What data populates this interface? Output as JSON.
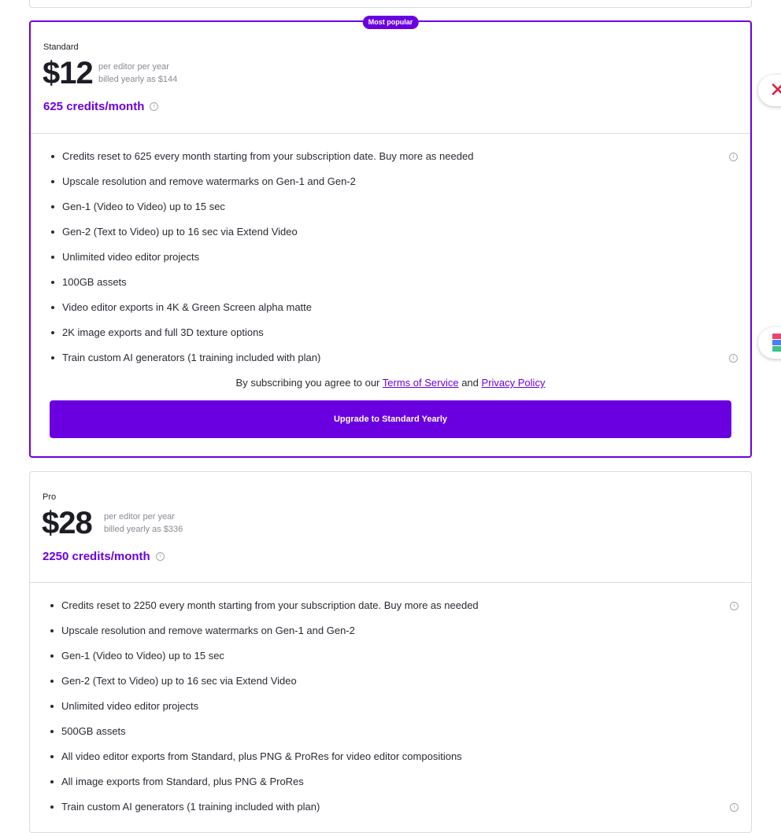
{
  "plans": {
    "standard": {
      "badge": "Most popular",
      "name": "Standard",
      "price": "$12",
      "per_editor": "per editor per year",
      "billed": "billed yearly as $144",
      "credits": "625 credits/month",
      "features": [
        {
          "text": "Credits reset to 625 every month starting from your subscription date. Buy more as needed",
          "info": true
        },
        {
          "text": "Upscale resolution and remove watermarks on Gen-1 and Gen-2",
          "info": false
        },
        {
          "text": "Gen-1 (Video to Video) up to 15 sec",
          "info": false
        },
        {
          "text": "Gen-2 (Text to Video) up to 16 sec via Extend Video",
          "info": false
        },
        {
          "text": "Unlimited video editor projects",
          "info": false
        },
        {
          "text": "100GB assets",
          "info": false
        },
        {
          "text": "Video editor exports in 4K & Green Screen alpha matte",
          "info": false
        },
        {
          "text": "2K image exports and full 3D texture options",
          "info": false
        },
        {
          "text": "Train custom AI generators (1 training included with plan)",
          "info": true
        }
      ],
      "agree_prefix": "By subscribing you agree to our",
      "terms_link": "Terms of Service",
      "agree_and": "and",
      "privacy_link": "Privacy Policy",
      "cta": "Upgrade to Standard Yearly"
    },
    "pro": {
      "name": "Pro",
      "price": "$28",
      "per_editor": "per editor per year",
      "billed": "billed yearly as $336",
      "credits": "2250 credits/month",
      "features": [
        {
          "text": "Credits reset to 2250 every month starting from your subscription date. Buy more as needed",
          "info": true
        },
        {
          "text": "Upscale resolution and remove watermarks on Gen-1 and Gen-2",
          "info": false
        },
        {
          "text": "Gen-1 (Video to Video) up to 15 sec",
          "info": false
        },
        {
          "text": "Gen-2 (Text to Video) up to 16 sec via Extend Video",
          "info": false
        },
        {
          "text": "Unlimited video editor projects",
          "info": false
        },
        {
          "text": "500GB assets",
          "info": false
        },
        {
          "text": "All video editor exports from Standard, plus PNG & ProRes for video editor compositions",
          "info": false
        },
        {
          "text": "All image exports from Standard, plus PNG & ProRes",
          "info": false
        },
        {
          "text": "Train custom AI generators (1 training included with plan)",
          "info": true
        }
      ]
    }
  },
  "icons": {
    "info": "info-circle-icon",
    "close_extension": "red-x-icon",
    "stack_extension": "colored-stack-icon"
  },
  "colors": {
    "accent": "#6a00e0",
    "text": "#1d1d27",
    "muted": "#8a8a94",
    "border": "#dcdce0"
  }
}
